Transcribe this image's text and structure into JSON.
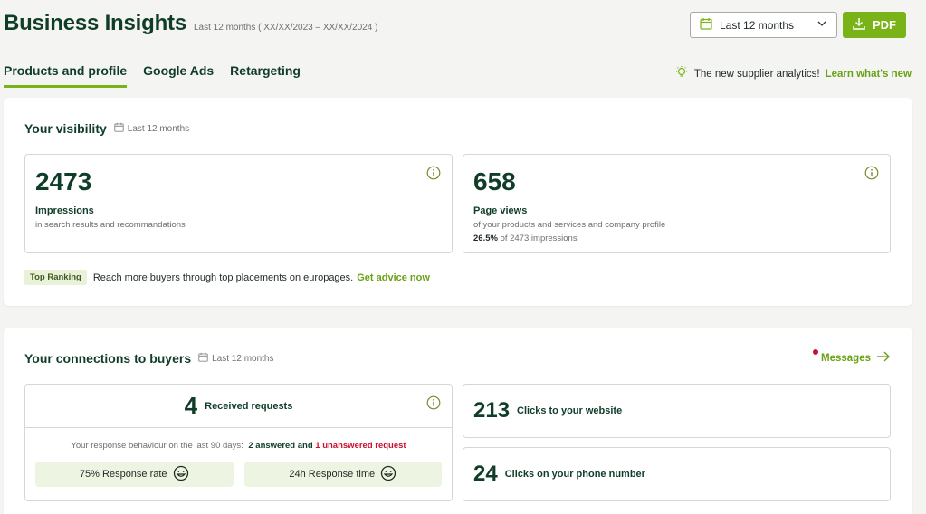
{
  "header": {
    "title": "Business Insights",
    "subtitle": "Last 12 months ( XX/XX/2023 – XX/XX/2024 )"
  },
  "period_select": {
    "value": "Last 12 months"
  },
  "pdf_button": {
    "label": "PDF"
  },
  "tabs": [
    {
      "label": "Products and profile",
      "active": true
    },
    {
      "label": "Google Ads",
      "active": false
    },
    {
      "label": "Retargeting",
      "active": false
    }
  ],
  "announcement": {
    "text": "The new supplier analytics!",
    "link": "Learn what's new"
  },
  "visibility": {
    "title": "Your visibility",
    "period": "Last 12 months",
    "impressions": {
      "value": "2473",
      "label": "Impressions",
      "sub": "in search results and recommandations"
    },
    "page_views": {
      "value": "658",
      "label": "Page views",
      "sub": "of your products and services and company profile",
      "percent": "26.5%",
      "percent_sub": "of 2473 impressions"
    },
    "ranking": {
      "badge": "Top Ranking",
      "text": "Reach more buyers through top placements on europages.",
      "link": "Get advice now"
    }
  },
  "connections": {
    "title": "Your connections to buyers",
    "period": "Last 12 months",
    "messages_link": "Messages",
    "requests": {
      "value": "4",
      "label": "Received requests",
      "behaviour_text": "Your response behaviour on the last 90 days:",
      "answered": "2 answered and",
      "unanswered": "1 unanswered request",
      "response_rate": "75% Response rate",
      "response_time": "24h Response time"
    },
    "website_clicks": {
      "value": "213",
      "label": "Clicks to your website"
    },
    "phone_clicks": {
      "value": "24",
      "label": "Clicks on your phone number"
    }
  },
  "colors": {
    "brand_green": "#7ab317",
    "dark_green": "#0f3d28",
    "alert_red": "#c8102e"
  }
}
